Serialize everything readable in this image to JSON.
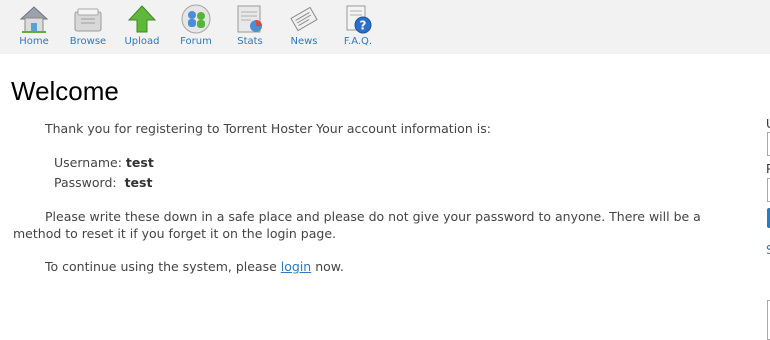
{
  "nav": {
    "items": [
      {
        "label": "Home",
        "icon": "home-icon"
      },
      {
        "label": "Browse",
        "icon": "browse-icon"
      },
      {
        "label": "Upload",
        "icon": "upload-arrow-icon"
      },
      {
        "label": "Forum",
        "icon": "forum-people-icon"
      },
      {
        "label": "Stats",
        "icon": "stats-chart-icon"
      },
      {
        "label": "News",
        "icon": "news-icon"
      },
      {
        "label": "F.A.Q.",
        "icon": "faq-help-icon"
      }
    ]
  },
  "main": {
    "title": "Welcome",
    "intro": "Thank you for registering to Torrent Hoster Your account information is:",
    "username_label": "Username:",
    "username_value": "test",
    "password_label": "Password:",
    "password_value": "test",
    "warning": "Please write these down in a safe place and please do not give your password to anyone. There will be a method to reset it if you forget it on the login page.",
    "continue_before": "To continue using the system, please",
    "continue_link": "login",
    "continue_after": "now."
  },
  "side": {
    "username_label_clipped": "U",
    "password_label_clipped": "P",
    "link_clipped": "S"
  },
  "colors": {
    "nav_background": "#f2f2f2",
    "link": "#2a7bbf",
    "text": "#444444"
  }
}
